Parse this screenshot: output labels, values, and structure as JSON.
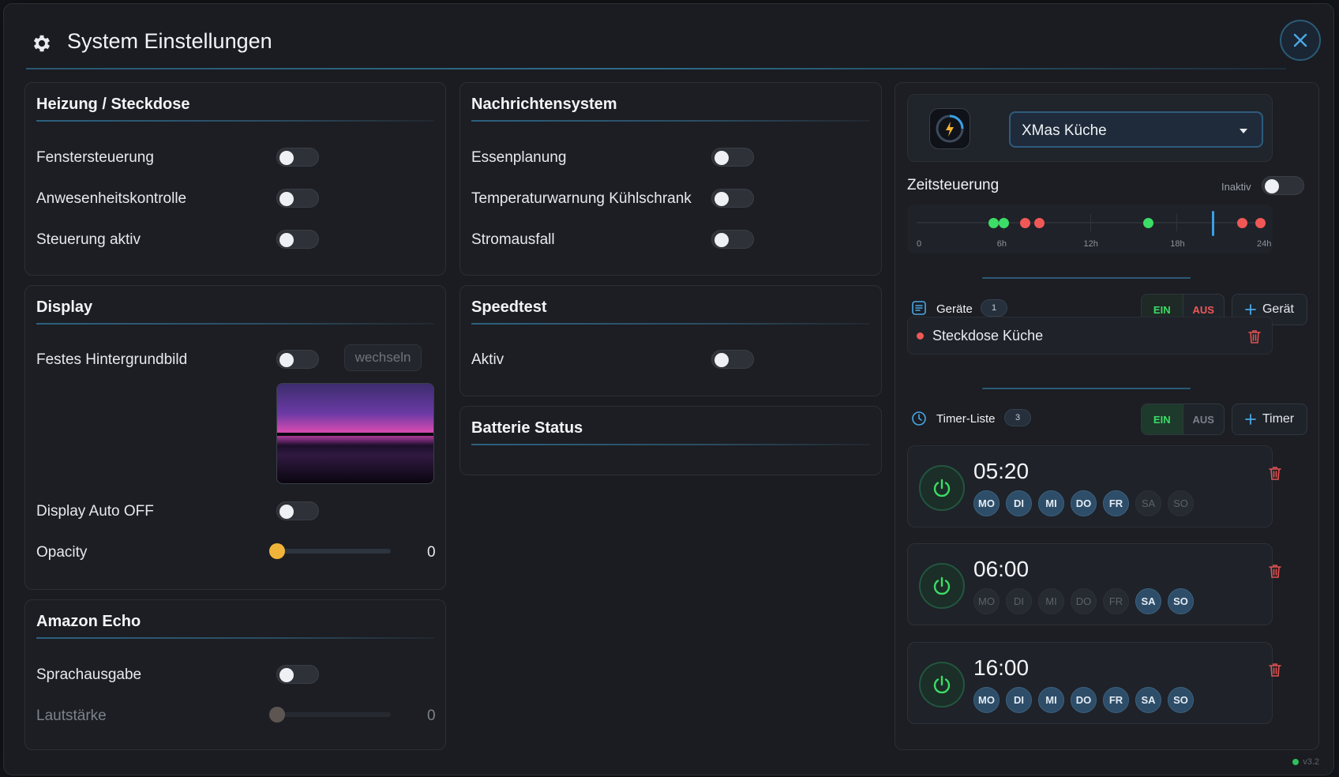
{
  "modal": {
    "title": "System Einstellungen"
  },
  "heizung": {
    "title": "Heizung / Steckdose",
    "rows": [
      {
        "label": "Fenstersteuerung",
        "on": false
      },
      {
        "label": "Anwesenheitskontrolle",
        "on": false
      },
      {
        "label": "Steuerung aktiv",
        "on": false
      }
    ]
  },
  "nachrichten": {
    "title": "Nachrichtensystem",
    "rows": [
      {
        "label": "Essenplanung",
        "on": false
      },
      {
        "label": "Temperaturwarnung Kühlschrank",
        "on": false
      },
      {
        "label": "Stromausfall",
        "on": false
      }
    ]
  },
  "display": {
    "title": "Display",
    "background_label": "Festes Hintergrundbild",
    "background_on": false,
    "change_button": "wechseln",
    "auto_off_label": "Display Auto OFF",
    "auto_off_on": false,
    "opacity_label": "Opacity",
    "opacity_value": "0",
    "opacity_fraction": 0
  },
  "speedtest": {
    "title": "Speedtest",
    "active_label": "Aktiv",
    "active_on": false
  },
  "batterie": {
    "title": "Batterie Status"
  },
  "echo": {
    "title": "Amazon Echo",
    "speech_label": "Sprachausgabe",
    "speech_on": false,
    "volume_label": "Lautstärke",
    "volume_value": "0",
    "volume_fraction": 0
  },
  "schedule": {
    "selected_device": "XMas Küche",
    "title": "Zeitsteuerung",
    "state_label": "Inaktiv",
    "timeline_labels": [
      "0",
      "6h",
      "12h",
      "18h",
      "24h"
    ],
    "timeline_events": [
      {
        "hour": 5.33,
        "color": "#3ddc66"
      },
      {
        "hour": 6.0,
        "color": "#3ddc66"
      },
      {
        "hour": 7.5,
        "color": "#f05858"
      },
      {
        "hour": 8.5,
        "color": "#f05858"
      },
      {
        "hour": 16.0,
        "color": "#3ddc66"
      },
      {
        "hour": 22.5,
        "color": "#f05858"
      },
      {
        "hour": 23.8,
        "color": "#f05858"
      }
    ],
    "now_hour": 20.5,
    "devices_label": "Geräte",
    "devices_count": "1",
    "on_label": "EIN",
    "off_label": "AUS",
    "add_device_label": "Gerät",
    "device_name": "Steckdose Küche",
    "timers_label": "Timer-Liste",
    "timers_count": "3",
    "add_timer_label": "Timer",
    "timers": [
      {
        "time": "05:20",
        "days": [
          {
            "d": "MO",
            "on": true
          },
          {
            "d": "DI",
            "on": true
          },
          {
            "d": "MI",
            "on": true
          },
          {
            "d": "DO",
            "on": true
          },
          {
            "d": "FR",
            "on": true
          },
          {
            "d": "SA",
            "on": false
          },
          {
            "d": "SO",
            "on": false
          }
        ]
      },
      {
        "time": "06:00",
        "days": [
          {
            "d": "MO",
            "on": false
          },
          {
            "d": "DI",
            "on": false
          },
          {
            "d": "MI",
            "on": false
          },
          {
            "d": "DO",
            "on": false
          },
          {
            "d": "FR",
            "on": false
          },
          {
            "d": "SA",
            "on": true
          },
          {
            "d": "SO",
            "on": true
          }
        ]
      },
      {
        "time": "16:00",
        "days": [
          {
            "d": "MO",
            "on": true
          },
          {
            "d": "DI",
            "on": true
          },
          {
            "d": "MI",
            "on": true
          },
          {
            "d": "DO",
            "on": true
          },
          {
            "d": "FR",
            "on": true
          },
          {
            "d": "SA",
            "on": true
          },
          {
            "d": "SO",
            "on": true
          }
        ]
      }
    ]
  },
  "version": "v3.2",
  "colors": {
    "accent": "#2e5c7e",
    "on_green": "#3ddc66",
    "off_red": "#f05858",
    "opacity_thumb": "#f0b43a"
  }
}
